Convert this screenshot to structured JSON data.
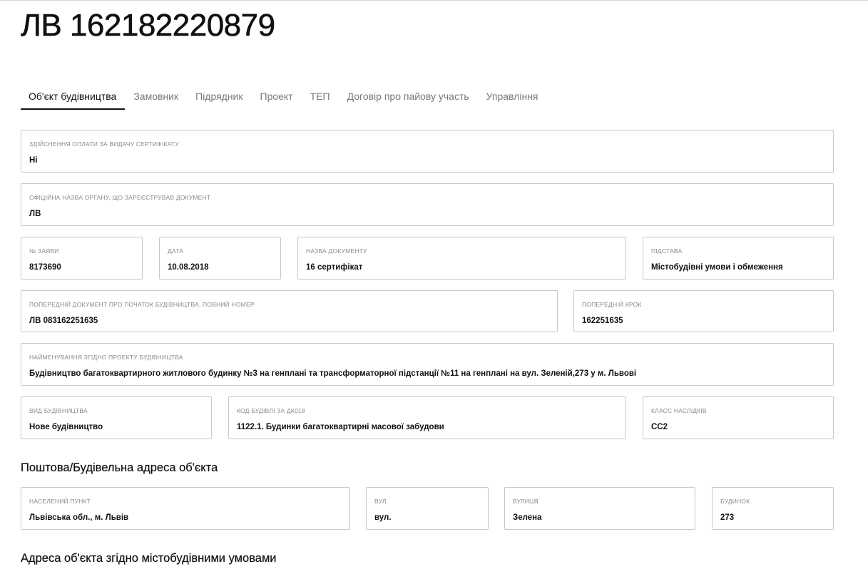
{
  "page": {
    "title": "ЛВ 162182220879"
  },
  "tabs": [
    {
      "label": "Об'єкт будівництва",
      "active": true
    },
    {
      "label": "Замовник",
      "active": false
    },
    {
      "label": "Підрядник",
      "active": false
    },
    {
      "label": "Проект",
      "active": false
    },
    {
      "label": "ТЕП",
      "active": false
    },
    {
      "label": "Договір про пайову участь",
      "active": false
    },
    {
      "label": "Управління",
      "active": false
    }
  ],
  "fields": {
    "payment": {
      "label": "Здійснення оплати за видачу сертифікату",
      "value": "Ні"
    },
    "authority": {
      "label": "Офіційна назва органу, що зареєстрував документ",
      "value": "ЛВ"
    },
    "application_no": {
      "label": "№ заяви",
      "value": "8173690"
    },
    "date": {
      "label": "Дата",
      "value": "10.08.2018"
    },
    "doc_name": {
      "label": "Назва документу",
      "value": "16 сертифікат"
    },
    "basis": {
      "label": "Підстава",
      "value": "Містобудівні умови і обмеження"
    },
    "prev_doc": {
      "label": "Попередній документ про початок будівництва, повний номер",
      "value": "ЛВ 083162251635"
    },
    "prev_step": {
      "label": "Попередній крок",
      "value": "162251635"
    },
    "project_name": {
      "label": "Найменування згідно проекту будівництва",
      "value": "Будівництво багатоквартирного житлового будинку №3 на генплані та трансформаторної підстанції №11 на генплані на вул. Зеленій,273 у м. Львові"
    },
    "construction_type": {
      "label": "Вид будівництва",
      "value": "Нове будівництво"
    },
    "building_code": {
      "label": "Код будівлі за ДК018",
      "value": "1122.1. Будинки багатоквартирні масової забудови"
    },
    "consequence_class": {
      "label": "Класс наслідків",
      "value": "СС2"
    }
  },
  "postal_address": {
    "heading": "Поштова/Будівельна адреса об'єкта",
    "settlement": {
      "label": "Населений пункт",
      "value": "Львівська обл., м. Львів"
    },
    "street_type": {
      "label": "Вул.",
      "value": "вул."
    },
    "street": {
      "label": "Вулиця",
      "value": "Зелена"
    },
    "building": {
      "label": "Будинок",
      "value": "273"
    }
  },
  "urban_address": {
    "heading": "Адреса об'єкта згідно містобудівними умовами"
  }
}
